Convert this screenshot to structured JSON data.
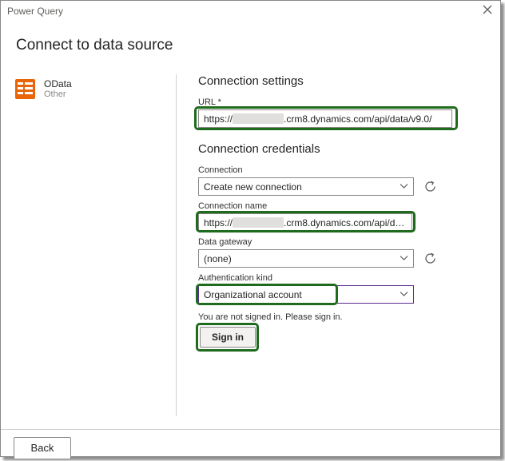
{
  "window": {
    "title": "Power Query"
  },
  "page": {
    "heading": "Connect to data source"
  },
  "source": {
    "name": "OData",
    "category": "Other",
    "icon": "odata-table-icon",
    "icon_color": "#e8650a"
  },
  "connection_settings": {
    "title": "Connection settings",
    "url_label": "URL *",
    "url_prefix": "https://",
    "url_suffix": ".crm8.dynamics.com/api/data/v9.0/"
  },
  "credentials": {
    "title": "Connection credentials",
    "connection_label": "Connection",
    "connection_value": "Create new connection",
    "connection_name_label": "Connection name",
    "connection_name_prefix": "https://",
    "connection_name_suffix": ".crm8.dynamics.com/api/da...",
    "gateway_label": "Data gateway",
    "gateway_value": "(none)",
    "auth_label": "Authentication kind",
    "auth_value": "Organizational account",
    "status_text": "You are not signed in. Please sign in.",
    "signin_label": "Sign in"
  },
  "footer": {
    "back_label": "Back"
  },
  "colors": {
    "highlight": "#1e6b1e",
    "accent_border": "#5c2d91"
  }
}
